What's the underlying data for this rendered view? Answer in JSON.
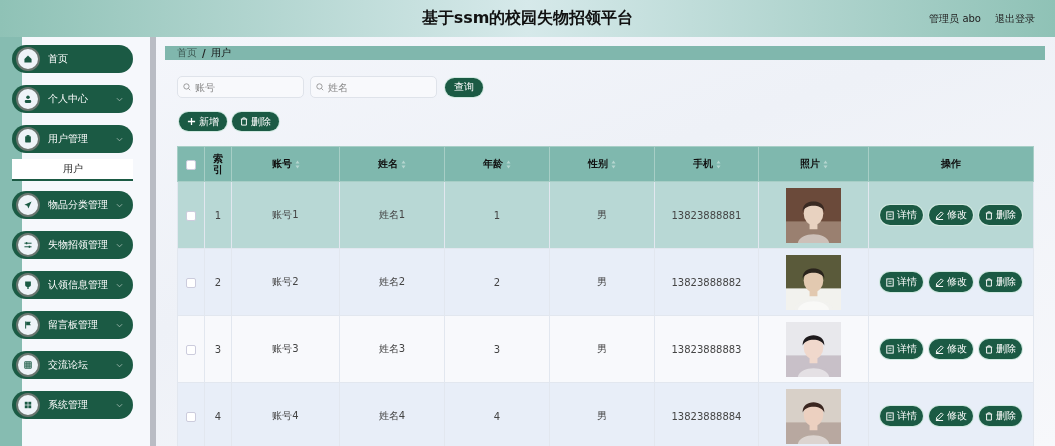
{
  "header": {
    "title": "基于ssm的校园失物招领平台",
    "user": "管理员 abo",
    "logout": "退出登录"
  },
  "sidebar": {
    "items": [
      {
        "label": "首页",
        "has_arrow": false
      },
      {
        "label": "个人中心",
        "has_arrow": true
      },
      {
        "label": "用户管理",
        "has_arrow": true,
        "children": [
          {
            "label": "用户",
            "selected": true
          }
        ]
      },
      {
        "label": "物品分类管理",
        "has_arrow": true
      },
      {
        "label": "失物招领管理",
        "has_arrow": true
      },
      {
        "label": "认领信息管理",
        "has_arrow": true
      },
      {
        "label": "留言板管理",
        "has_arrow": true
      },
      {
        "label": "交流论坛",
        "has_arrow": true
      },
      {
        "label": "系统管理",
        "has_arrow": true
      }
    ]
  },
  "breadcrumb": {
    "items": [
      "首页",
      "用户"
    ],
    "separator": "/"
  },
  "search": {
    "fields": [
      {
        "placeholder": "账号"
      },
      {
        "placeholder": "姓名"
      }
    ],
    "button": "查询"
  },
  "actions": [
    {
      "label": "新增",
      "kind": "add"
    },
    {
      "label": "删除",
      "kind": "delete"
    }
  ],
  "table": {
    "all_checked": false,
    "columns": [
      {
        "label": "索引",
        "sortable": false
      },
      {
        "label": "账号",
        "sortable": true
      },
      {
        "label": "姓名",
        "sortable": true
      },
      {
        "label": "年龄",
        "sortable": true
      },
      {
        "label": "性别",
        "sortable": true
      },
      {
        "label": "手机",
        "sortable": true
      },
      {
        "label": "照片",
        "sortable": true
      },
      {
        "label": "操作",
        "sortable": false
      }
    ],
    "rows": [
      {
        "index": "1",
        "account": "账号1",
        "name": "姓名1",
        "age": "1",
        "gender": "男",
        "phone": "13823888881",
        "selected": true,
        "checked": false,
        "actions": [
          {
            "label": "详情",
            "kind": "detail"
          },
          {
            "label": "修改",
            "kind": "edit"
          },
          {
            "label": "删除",
            "kind": "delete"
          }
        ]
      },
      {
        "index": "2",
        "account": "账号2",
        "name": "姓名2",
        "age": "2",
        "gender": "男",
        "phone": "13823888882",
        "selected": false,
        "checked": false,
        "actions": [
          {
            "label": "详情",
            "kind": "detail"
          },
          {
            "label": "修改",
            "kind": "edit"
          },
          {
            "label": "删除",
            "kind": "delete"
          }
        ]
      },
      {
        "index": "3",
        "account": "账号3",
        "name": "姓名3",
        "age": "3",
        "gender": "男",
        "phone": "13823888883",
        "selected": false,
        "checked": false,
        "actions": [
          {
            "label": "详情",
            "kind": "detail"
          },
          {
            "label": "修改",
            "kind": "edit"
          },
          {
            "label": "删除",
            "kind": "delete"
          }
        ]
      },
      {
        "index": "4",
        "account": "账号4",
        "name": "姓名4",
        "age": "4",
        "gender": "男",
        "phone": "13823888884",
        "selected": false,
        "checked": false,
        "actions": [
          {
            "label": "详情",
            "kind": "detail"
          },
          {
            "label": "修改",
            "kind": "edit"
          },
          {
            "label": "删除",
            "kind": "delete"
          }
        ]
      }
    ]
  }
}
